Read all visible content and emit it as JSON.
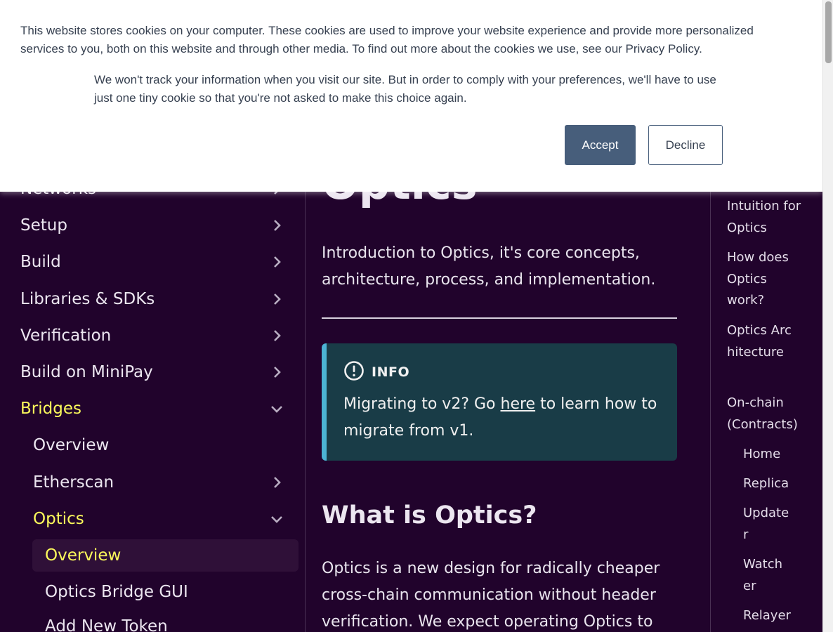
{
  "cookie_banner": {
    "message": "This website stores cookies on your computer. These cookies are used to improve your website experience and provide more personalized services to you, both on this website and through other media. To find out more about the cookies we use, see our Privacy Policy.",
    "preference_note": "We won't track your information when you visit our site. But in order to comply with your preferences, we'll have to use just one tiny cookie so that you're not asked to make this choice again.",
    "accept_label": "Accept",
    "decline_label": "Decline"
  },
  "sidebar": {
    "items": [
      {
        "label": "Networks",
        "expanded": false
      },
      {
        "label": "Setup",
        "expanded": false
      },
      {
        "label": "Build",
        "expanded": false
      },
      {
        "label": "Libraries & SDKs",
        "expanded": false
      },
      {
        "label": "Verification",
        "expanded": false
      },
      {
        "label": "Build on MiniPay",
        "expanded": false
      },
      {
        "label": "Bridges",
        "expanded": true,
        "active": true
      },
      {
        "label": "Overview"
      },
      {
        "label": "Etherscan",
        "expanded": false
      },
      {
        "label": "Optics",
        "expanded": true,
        "active": true
      },
      {
        "label": "Overview",
        "current": true
      },
      {
        "label": "Optics Bridge GUI"
      },
      {
        "label": "Add New Token"
      }
    ]
  },
  "main": {
    "title": "Optics",
    "subtitle": "Introduction to Optics, it's core concepts, architecture, process, and implementation.",
    "info": {
      "title": "INFO",
      "before_link": "Migrating to v2? Go ",
      "link_text": "here",
      "after_link": " to learn how to migrate from v1."
    },
    "section_heading": "What is Optics?",
    "paragraph": "Optics is a new design for radically cheaper cross-chain communication without header verification. We expect operating Optics to cut"
  },
  "toc": {
    "items": [
      {
        "label": "Intuition for Optics"
      },
      {
        "label": "How does Optics work?"
      },
      {
        "label": "Optics Architecture"
      },
      {
        "label": "On-chain (Contracts)"
      },
      {
        "label": "Home"
      },
      {
        "label": "Replica"
      },
      {
        "label": "Updater"
      },
      {
        "label": "Watcher"
      },
      {
        "label": "Relayer"
      }
    ]
  },
  "colors": {
    "background": "#21032c",
    "active_nav": "#fcf95b",
    "info_bg": "#193c47",
    "info_accent": "#4cb3d4",
    "accept_button": "#475e7b"
  }
}
